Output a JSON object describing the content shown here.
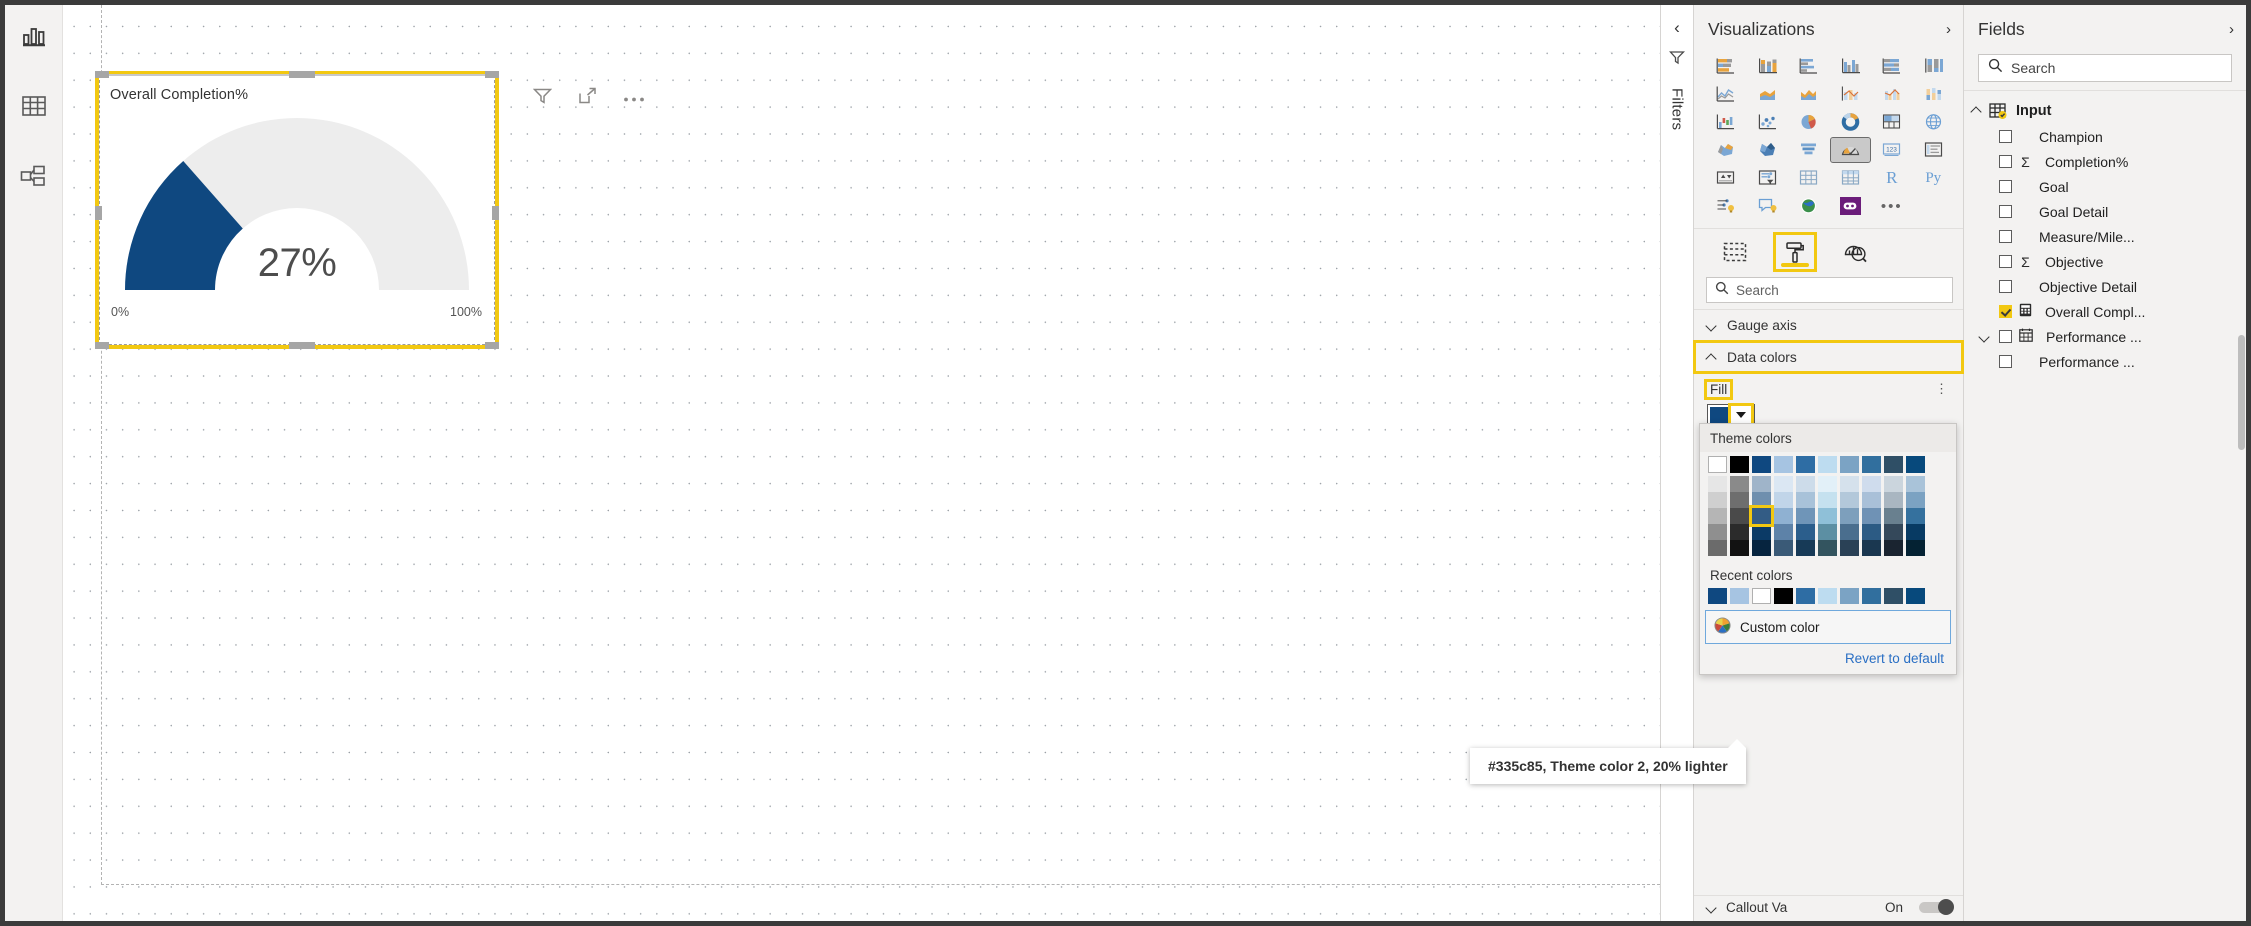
{
  "left_rail": [
    {
      "name": "report-view",
      "icon": "bar-chart-icon"
    },
    {
      "name": "data-view",
      "icon": "table-icon"
    },
    {
      "name": "model-view",
      "icon": "relationships-icon"
    }
  ],
  "canvas": {
    "visual": {
      "title": "Overall Completion%",
      "type": "gauge",
      "header_icons": [
        "filter-icon",
        "focus-mode-icon",
        "more-options-icon"
      ]
    }
  },
  "chart_data": {
    "type": "gauge",
    "title": "Overall Completion%",
    "value": 27,
    "value_label": "27%",
    "min": 0,
    "min_label": "0%",
    "max": 100,
    "max_label": "100%",
    "fill_color": "#0f4880",
    "track_color": "#ededed",
    "start_angle": 180,
    "end_angle": 360,
    "xlabel": "",
    "ylabel": "",
    "grid": false,
    "legend": "none"
  },
  "filters": {
    "collapse_label": "‹",
    "label": "Filters"
  },
  "visualizations": {
    "title": "Visualizations",
    "expand_label": "›",
    "icons": [
      "stacked-bar-chart-icon",
      "stacked-column-chart-icon",
      "clustered-bar-chart-icon",
      "clustered-column-chart-icon",
      "100-stacked-bar-chart-icon",
      "100-stacked-column-chart-icon",
      "line-chart-icon",
      "area-chart-icon",
      "stacked-area-chart-icon",
      "line-and-stacked-column-chart-icon",
      "line-and-clustered-column-chart-icon",
      "ribbon-chart-icon",
      "waterfall-chart-icon",
      "scatter-chart-icon",
      "pie-chart-icon",
      "donut-chart-icon",
      "treemap-icon",
      "map-icon",
      "filled-map-icon",
      "shape-map-icon",
      "funnel-icon",
      "gauge-icon",
      "card-icon",
      "multi-row-card-icon",
      "kpi-icon",
      "slicer-icon",
      "table-icon",
      "matrix-icon",
      "r-script-visual-icon",
      "python-visual-icon",
      "key-influencers-icon",
      "qna-icon",
      "arcgis-map-icon",
      "paginated-report-icon",
      "more-visuals-icon"
    ],
    "selected_icon": "gauge-icon",
    "tabs": [
      {
        "name": "fields-tab",
        "icon": "fields-pane-icon",
        "active": false
      },
      {
        "name": "format-tab",
        "icon": "paint-roller-icon",
        "active": true
      },
      {
        "name": "analytics-tab",
        "icon": "analytics-magnifier-icon",
        "active": false
      }
    ],
    "search_placeholder": "Search",
    "sections": [
      {
        "label": "Gauge axis",
        "expanded": false,
        "highlighted": false
      },
      {
        "label": "Data colors",
        "expanded": true,
        "highlighted": true
      }
    ],
    "fill": {
      "label": "Fill",
      "current_color": "#0f4880",
      "kebab": "⋮"
    },
    "color_popup": {
      "theme_header": "Theme colors",
      "recent_header": "Recent colors",
      "custom_label": "Custom color",
      "revert_label": "Revert to default",
      "selected_swatch": "#335c85",
      "theme_top_row": [
        "#ffffff",
        "#000000",
        "#0f4880",
        "#a6c4e2",
        "#2e6da4",
        "#bddcf0",
        "#7ba3c4",
        "#316f9e",
        "#2f4f66",
        "#07497c"
      ],
      "theme_columns": [
        [
          "#e6e6e6",
          "#cfcfcf",
          "#b5b5b5",
          "#8f8f8f",
          "#6b6b6b"
        ],
        [
          "#8a8a8a",
          "#6e6e6e",
          "#4a4a4a",
          "#2b2b2b",
          "#121212"
        ],
        [
          "#9fb4c9",
          "#6f8fae",
          "#335c85",
          "#0b3a66",
          "#06243f"
        ],
        [
          "#dbe7f3",
          "#c1d5e9",
          "#8fb1d2",
          "#5d82a8",
          "#3a5a77"
        ],
        [
          "#cddcea",
          "#a8c2d9",
          "#6f95b8",
          "#2b5e8c",
          "#173a57"
        ],
        [
          "#e2f0f8",
          "#c5e1ef",
          "#8fc0d8",
          "#5c8fa3",
          "#33545f"
        ],
        [
          "#d5e1ec",
          "#b3c8da",
          "#7d9fbc",
          "#4a6e8e",
          "#2a4156"
        ],
        [
          "#cfdced",
          "#a9c0d8",
          "#6f92b5",
          "#2c5b84",
          "#1a3750"
        ],
        [
          "#cbd5dd",
          "#a9b6c1",
          "#69808f",
          "#34485a",
          "#1a2430"
        ],
        [
          "#a9c3d9",
          "#7ba2c2",
          "#35719e",
          "#073a63",
          "#042233"
        ]
      ],
      "recent_colors": [
        "#0f4880",
        "#a6c4e2",
        "#ffffff",
        "#000000",
        "#2e6da4",
        "#bddcf0",
        "#7ba3c4",
        "#316f9e",
        "#2f4f66",
        "#07497c"
      ]
    },
    "tooltip": "#335c85, Theme color 2, 20% lighter",
    "callout": {
      "label": "Callout Va",
      "state": "On"
    }
  },
  "fields": {
    "title": "Fields",
    "expand_label": "›",
    "search_placeholder": "Search",
    "table_name": "Input",
    "items": [
      {
        "label": "Champion",
        "checked": false,
        "aggregate": false,
        "icon": "none",
        "expandable": false
      },
      {
        "label": "Completion%",
        "checked": false,
        "aggregate": true,
        "icon": "sigma",
        "expandable": false
      },
      {
        "label": "Goal",
        "checked": false,
        "aggregate": false,
        "icon": "none",
        "expandable": false
      },
      {
        "label": "Goal Detail",
        "checked": false,
        "aggregate": false,
        "icon": "none",
        "expandable": false
      },
      {
        "label": "Measure/Mile...",
        "checked": false,
        "aggregate": false,
        "icon": "none",
        "expandable": false
      },
      {
        "label": "Objective",
        "checked": false,
        "aggregate": true,
        "icon": "sigma",
        "expandable": false
      },
      {
        "label": "Objective Detail",
        "checked": false,
        "aggregate": false,
        "icon": "none",
        "expandable": false
      },
      {
        "label": "Overall Compl...",
        "checked": true,
        "aggregate": false,
        "icon": "measure-icon",
        "expandable": false
      },
      {
        "label": "Performance ...",
        "checked": false,
        "aggregate": false,
        "icon": "date-table-icon",
        "expandable": true
      },
      {
        "label": "Performance ...",
        "checked": false,
        "aggregate": false,
        "icon": "none",
        "expandable": false
      }
    ]
  }
}
